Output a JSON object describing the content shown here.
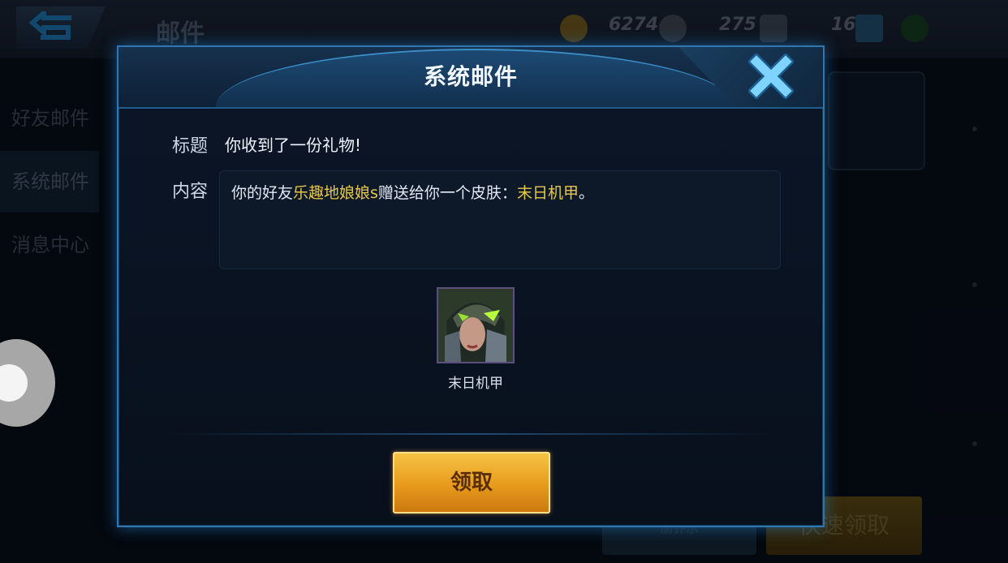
{
  "background": {
    "title": "邮件",
    "resources": [
      {
        "value": "6274"
      },
      {
        "value": "275"
      },
      {
        "value": "16"
      }
    ],
    "tabs": [
      "好友邮件",
      "系统邮件",
      "消息中心"
    ],
    "bottom_buttons": [
      "删除",
      "快速领取"
    ]
  },
  "dialog": {
    "title": "系统邮件",
    "subject_label": "标题",
    "subject_value": "你收到了一份礼物!",
    "content_label": "内容",
    "content": {
      "prefix": "你的好友",
      "friend": "乐趣地娘娘s",
      "middle": "赠送给你一个皮肤：",
      "skin": "末日机甲",
      "suffix": "。"
    },
    "reward_item": {
      "name": "末日机甲",
      "icon": "skin-portrait-icon"
    },
    "claim_label": "领取",
    "close_icon": "close-icon"
  },
  "colors": {
    "accent_blue": "#2f77b2",
    "highlight_gold": "#e7c94a",
    "claim_button": "#e79a1c"
  }
}
